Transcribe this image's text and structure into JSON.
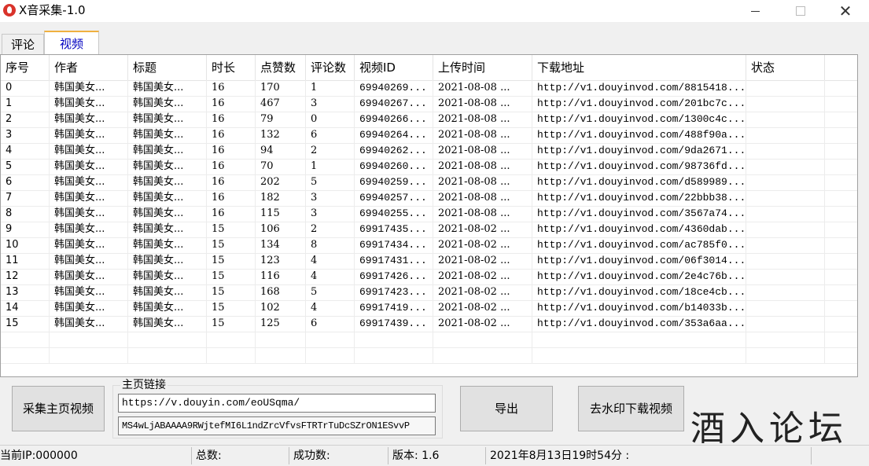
{
  "window": {
    "title": "X音采集-1.0",
    "minimize": "",
    "maximize": "",
    "close": "✕"
  },
  "tabs": [
    {
      "label": "评论",
      "selected": false
    },
    {
      "label": "视频",
      "selected": true
    }
  ],
  "table": {
    "columns": [
      "序号",
      "作者",
      "标题",
      "时长",
      "点赞数",
      "评论数",
      "视频ID",
      "上传时间",
      "下载地址",
      "状态"
    ],
    "rows": [
      [
        "0",
        "韩国美女...",
        "韩国美女...",
        "16",
        "170",
        "1",
        "69940269...",
        "2021-08-08 ...",
        "http://v1.douyinvod.com/8815418...",
        ""
      ],
      [
        "1",
        "韩国美女...",
        "韩国美女...",
        "16",
        "467",
        "3",
        "69940267...",
        "2021-08-08 ...",
        "http://v1.douyinvod.com/201bc7c...",
        ""
      ],
      [
        "2",
        "韩国美女...",
        "韩国美女...",
        "16",
        "79",
        "0",
        "69940266...",
        "2021-08-08 ...",
        "http://v1.douyinvod.com/1300c4c...",
        ""
      ],
      [
        "3",
        "韩国美女...",
        "韩国美女...",
        "16",
        "132",
        "6",
        "69940264...",
        "2021-08-08 ...",
        "http://v1.douyinvod.com/488f90a...",
        ""
      ],
      [
        "4",
        "韩国美女...",
        "韩国美女...",
        "16",
        "94",
        "2",
        "69940262...",
        "2021-08-08 ...",
        "http://v1.douyinvod.com/9da2671...",
        ""
      ],
      [
        "5",
        "韩国美女...",
        "韩国美女...",
        "16",
        "70",
        "1",
        "69940260...",
        "2021-08-08 ...",
        "http://v1.douyinvod.com/98736fd...",
        ""
      ],
      [
        "6",
        "韩国美女...",
        "韩国美女...",
        "16",
        "202",
        "5",
        "69940259...",
        "2021-08-08 ...",
        "http://v1.douyinvod.com/d589989...",
        ""
      ],
      [
        "7",
        "韩国美女...",
        "韩国美女...",
        "16",
        "182",
        "3",
        "69940257...",
        "2021-08-08 ...",
        "http://v1.douyinvod.com/22bbb38...",
        ""
      ],
      [
        "8",
        "韩国美女...",
        "韩国美女...",
        "16",
        "115",
        "3",
        "69940255...",
        "2021-08-08 ...",
        "http://v1.douyinvod.com/3567a74...",
        ""
      ],
      [
        "9",
        "韩国美女...",
        "韩国美女...",
        "15",
        "106",
        "2",
        "69917435...",
        "2021-08-02 ...",
        "http://v1.douyinvod.com/4360dab...",
        ""
      ],
      [
        "10",
        "韩国美女...",
        "韩国美女...",
        "15",
        "134",
        "8",
        "69917434...",
        "2021-08-02 ...",
        "http://v1.douyinvod.com/ac785f0...",
        ""
      ],
      [
        "11",
        "韩国美女...",
        "韩国美女...",
        "15",
        "123",
        "4",
        "69917431...",
        "2021-08-02 ...",
        "http://v1.douyinvod.com/06f3014...",
        ""
      ],
      [
        "12",
        "韩国美女...",
        "韩国美女...",
        "15",
        "116",
        "4",
        "69917426...",
        "2021-08-02 ...",
        "http://v1.douyinvod.com/2e4c76b...",
        ""
      ],
      [
        "13",
        "韩国美女...",
        "韩国美女...",
        "15",
        "168",
        "5",
        "69917423...",
        "2021-08-02 ...",
        "http://v1.douyinvod.com/18ce4cb...",
        ""
      ],
      [
        "14",
        "韩国美女...",
        "韩国美女...",
        "15",
        "102",
        "4",
        "69917419...",
        "2021-08-02 ...",
        "http://v1.douyinvod.com/b14033b...",
        ""
      ],
      [
        "15",
        "韩国美女...",
        "韩国美女...",
        "15",
        "125",
        "6",
        "69917439...",
        "2021-08-02 ...",
        "http://v1.douyinvod.com/353a6aa...",
        ""
      ]
    ]
  },
  "controls": {
    "collect_button": "采集主页视频",
    "homepage_group_label": "主页链接",
    "homepage_url": "https://v.douyin.com/eoUSqma/",
    "token_field": "MS4wLjABAAAA9RWjtefMI6L1ndZrcVfvsFTRTrTuDcSZrON1ESvvP",
    "export_button": "导出",
    "download_button": "去水印下载视频"
  },
  "watermark": "酒入论坛",
  "status_bar": {
    "ip": "当前IP:000000",
    "total": "总数:",
    "success": "成功数:",
    "version": "版本: 1.6",
    "datetime": "2021年8月13日19时54分 :"
  },
  "colors": {
    "window_bg": "#f0f0f0",
    "selected_tab_text": "#0000c0",
    "tab_accent": "#f0b040",
    "app_icon": "#d9332b"
  }
}
